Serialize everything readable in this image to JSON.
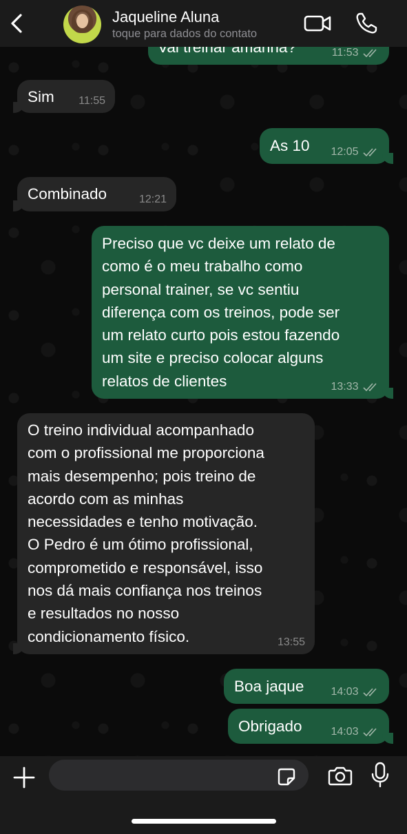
{
  "header": {
    "contact_name": "Jaqueline Aluna",
    "contact_subtitle": "toque para dados do contato",
    "back_icon": "chevron-left-icon",
    "video_icon": "video-camera-icon",
    "phone_icon": "phone-icon"
  },
  "messages": [
    {
      "direction": "out",
      "text": "Vai treinar amanhã?",
      "time": "11:53",
      "read": true
    },
    {
      "direction": "in",
      "text": "Sim",
      "time": "11:55"
    },
    {
      "direction": "out",
      "text": "As 10",
      "time": "12:05",
      "read": true
    },
    {
      "direction": "in",
      "text": "Combinado",
      "time": "12:21"
    },
    {
      "direction": "out",
      "text": "Preciso que vc deixe um relato de\ncomo é o meu trabalho como\npersonal trainer, se vc sentiu\ndiferença com os treinos, pode ser\num relato curto pois estou fazendo\num site e preciso colocar alguns\nrelatos de clientes",
      "time": "13:33",
      "read": true
    },
    {
      "direction": "in",
      "text": "O treino individual acompanhado\ncom o profissional me proporciona\nmais desempenho; pois treino de\nacordo com as minhas\nnecessidades e tenho motivação.\nO Pedro é um ótimo profissional,\ncomprometido e responsável, isso\nnos dá mais confiança nos treinos\ne resultados no nosso\ncondicionamento físico.",
      "time": "13:55"
    },
    {
      "direction": "out",
      "text": "Boa jaque",
      "time": "14:03",
      "read": true
    },
    {
      "direction": "out",
      "text": "Obrigado",
      "time": "14:03",
      "read": true
    }
  ],
  "input_bar": {
    "placeholder": "",
    "plus_icon": "plus-icon",
    "sticker_icon": "sticker-icon",
    "camera_icon": "camera-icon",
    "mic_icon": "microphone-icon"
  },
  "colors": {
    "incoming_bubble": "#262626",
    "outgoing_bubble": "#1d5b3d",
    "background": "#0b0b0b",
    "bar": "#1b1b1b"
  }
}
